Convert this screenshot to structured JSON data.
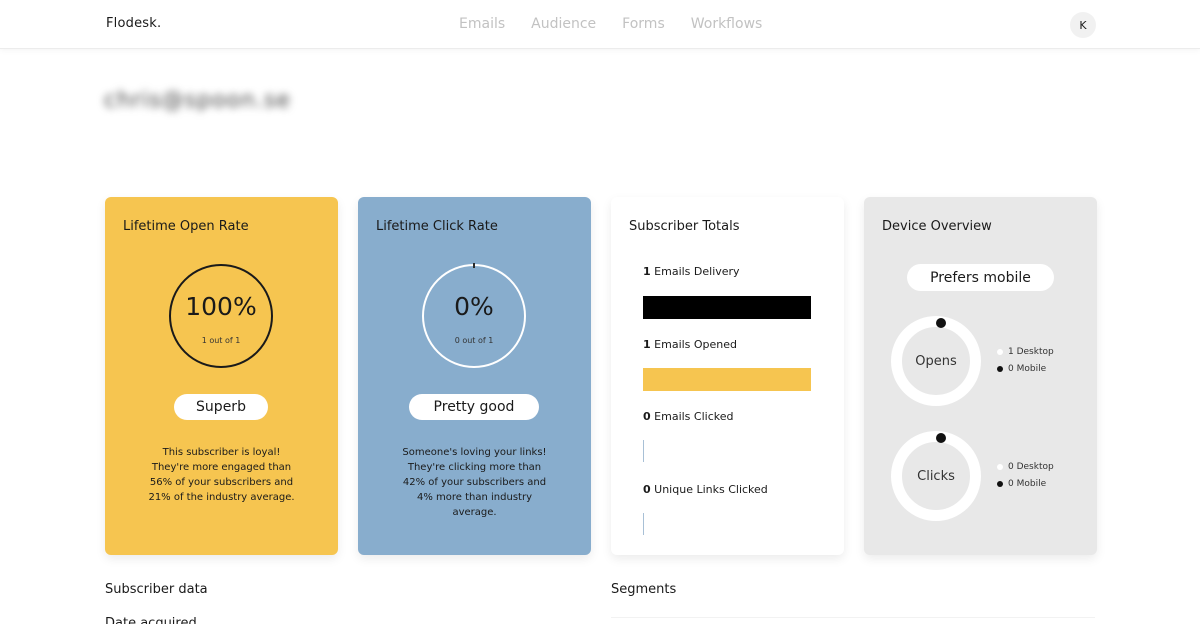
{
  "header": {
    "logo": "Flodesk.",
    "nav": [
      "Emails",
      "Audience",
      "Forms",
      "Workflows"
    ],
    "avatar_initial": "K"
  },
  "subscriber_email": "chris@spoon.se",
  "open_rate": {
    "title": "Lifetime Open Rate",
    "percent": "100%",
    "count": "1 out of 1",
    "rating": "Superb",
    "description": "This subscriber is loyal! They're more engaged than 56% of your subscribers and 21% of the industry average."
  },
  "click_rate": {
    "title": "Lifetime Click Rate",
    "percent": "0%",
    "count": "0 out of 1",
    "rating": "Pretty good",
    "description": "Someone's loving your links! They're clicking more than 42% of your subscribers and 4% more than industry average."
  },
  "totals": {
    "title": "Subscriber Totals",
    "rows": [
      {
        "count": "1",
        "label": "Emails Delivery",
        "bar_fraction": 1.0,
        "color": "#000000"
      },
      {
        "count": "1",
        "label": "Emails Opened",
        "bar_fraction": 1.0,
        "color": "#f6c550"
      },
      {
        "count": "0",
        "label": "Emails Clicked",
        "bar_fraction": 0.0,
        "color": "#a8c0d6"
      },
      {
        "count": "0",
        "label": "Unique Links Clicked",
        "bar_fraction": 0.0,
        "color": "#a8c0d6"
      }
    ]
  },
  "device": {
    "title": "Device Overview",
    "preference": "Prefers mobile",
    "opens": {
      "label": "Opens",
      "desktop": "1 Desktop",
      "mobile": "0 Mobile"
    },
    "clicks": {
      "label": "Clicks",
      "desktop": "0 Desktop",
      "mobile": "0 Mobile"
    }
  },
  "sections": {
    "subscriber_data": "Subscriber data",
    "segments": "Segments",
    "sub_heading": "Date acquired"
  },
  "colors": {
    "open_card": "#f6c550",
    "click_card": "#88adcd",
    "device_card": "#e8e8e8"
  }
}
